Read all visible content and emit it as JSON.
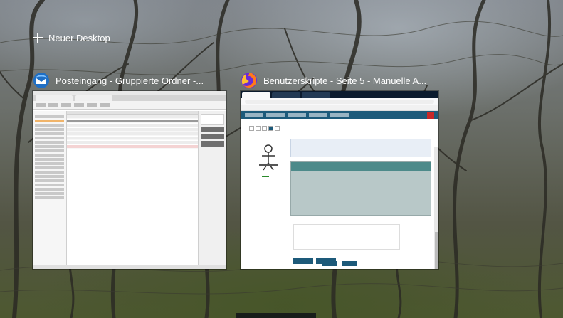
{
  "new_desktop": {
    "label": "Neuer Desktop",
    "icon": "plus-icon"
  },
  "windows": [
    {
      "app": "Thunderbird",
      "icon": "thunderbird-icon",
      "title": "Posteingang - Gruppierte Ordner -..."
    },
    {
      "app": "Firefox",
      "icon": "firefox-icon",
      "title": "Benutzerskripte - Seite 5 - Manuelle A..."
    }
  ],
  "colors": {
    "text": "#ffffff",
    "thunderbird_accent": "#1f6fc5",
    "firefox_site_accent": "#1d5a7a"
  }
}
